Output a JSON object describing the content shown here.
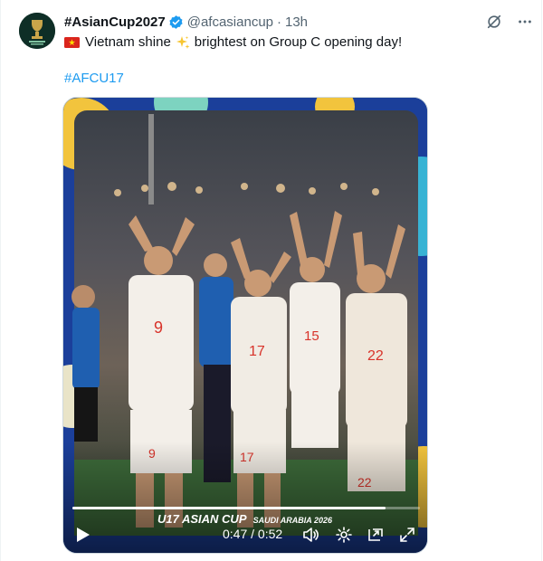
{
  "tweet": {
    "display_name": "#AsianCup2027",
    "handle": "@afcasiancup",
    "separator": "·",
    "time": "13h",
    "text_before": "Vietnam shine",
    "text_after": "brightest on Group C opening day!",
    "hashtag": "#AFCU17",
    "avatar_alt": "AFC Asian Cup 2027 logo"
  },
  "icons": {
    "verified": "verified-badge-icon",
    "grok": "grok-icon",
    "more": "more-icon",
    "flag": "vietnam-flag-icon",
    "sparkle": "sparkles-icon",
    "play": "play-icon",
    "volume": "volume-icon",
    "settings": "settings-icon",
    "pip": "picture-in-picture-icon",
    "fullscreen": "fullscreen-icon"
  },
  "video": {
    "overlay_text": "U17 ASIAN CUP",
    "overlay_sub": "SAUDI ARABIA 2026",
    "current_time": "0:47",
    "duration": "0:52",
    "time_separator": " / ",
    "progress": 0.9
  },
  "colors": {
    "link": "#1d9bf0",
    "verified": "#1d9bf0",
    "muted": "#536471",
    "jersey": "#f3efe9",
    "jersey_accent": "#d8332a"
  }
}
